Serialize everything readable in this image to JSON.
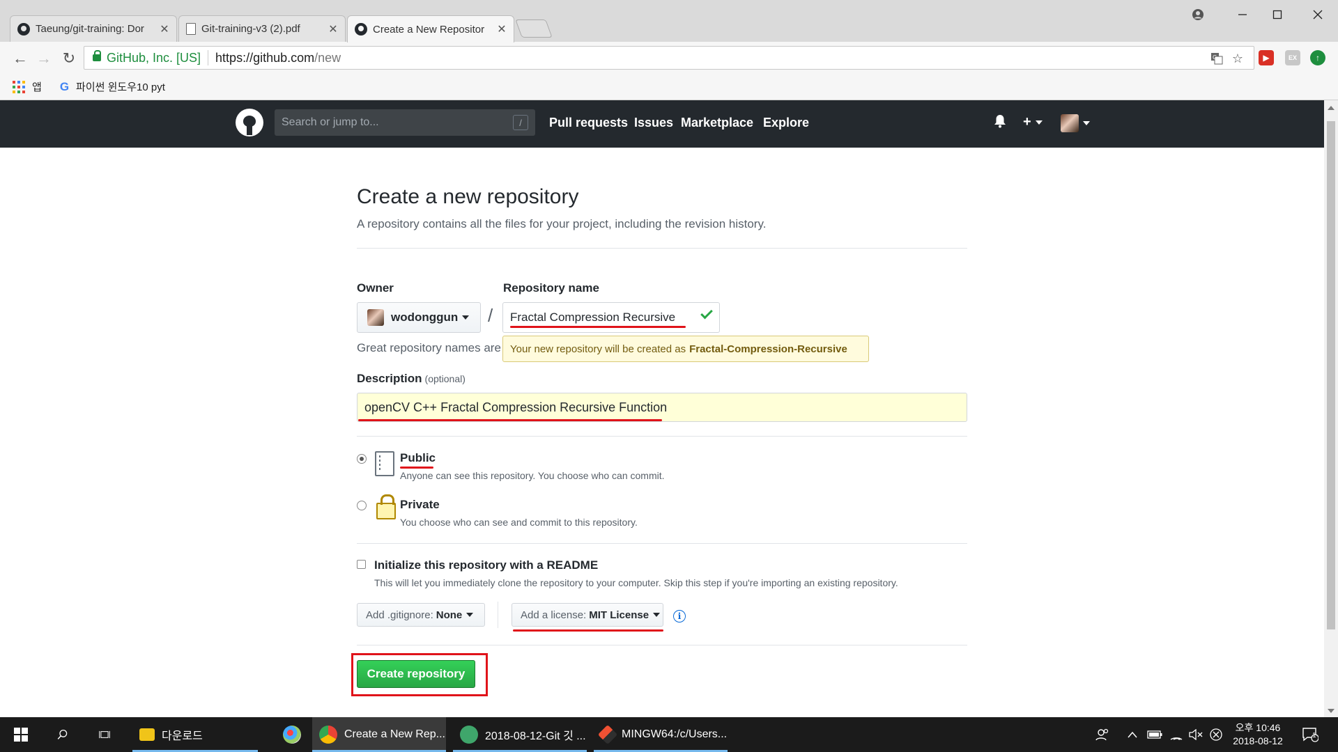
{
  "browser": {
    "tabs": [
      {
        "title": "Taeung/git-training: Dor",
        "icon": "github-icon"
      },
      {
        "title": "Git-training-v3 (2).pdf",
        "icon": "document-icon"
      },
      {
        "title": "Create a New Repositor",
        "icon": "github-icon"
      }
    ],
    "close_glyph": "✕",
    "address": {
      "ev_label": "GitHub, Inc. [US]",
      "url_host": "https://github.com",
      "url_path": "/new"
    },
    "bookmarks": {
      "apps_label": "앱",
      "item_label": "파이썬 윈도우10 pyt"
    }
  },
  "github": {
    "header": {
      "search_placeholder": "Search or jump to...",
      "search_key": "/",
      "nav": [
        "Pull requests",
        "Issues",
        "Marketplace",
        "Explore"
      ],
      "plus_label": "+"
    },
    "page": {
      "title": "Create a new repository",
      "subtitle": "A repository contains all the files for your project, including the revision history.",
      "owner_label": "Owner",
      "owner_value": "wodonggun",
      "repo_name_label": "Repository name",
      "repo_name_value": "Fractal Compression Recursive",
      "slash": "/",
      "hint_text": "Great repository names are",
      "tooltip_prefix": "Your new repository will be created as",
      "tooltip_name": "Fractal-Compression-Recursive",
      "description_label": "Description",
      "description_optional": "(optional)",
      "description_value": "openCV C++ Fractal Compression Recursive Function",
      "visibility": {
        "selected": "public",
        "public_title": "Public",
        "public_desc": "Anyone can see this repository. You choose who can commit.",
        "private_title": "Private",
        "private_desc": "You choose who can see and commit to this repository."
      },
      "init_readme_label": "Initialize this repository with a README",
      "init_readme_desc": "This will let you immediately clone the repository to your computer. Skip this step if you're importing an existing repository.",
      "gitignore_label": "Add .gitignore:",
      "gitignore_value": "None",
      "license_label": "Add a license:",
      "license_value": "MIT License",
      "info_glyph": "i",
      "create_button": "Create repository"
    }
  },
  "taskbar": {
    "items": [
      {
        "label": "다운로드"
      },
      {
        "label": "Create a New Rep..."
      },
      {
        "label": "2018-08-12-Git 깃 ..."
      },
      {
        "label": "MINGW64:/c/Users..."
      }
    ],
    "clock_time": "오후 10:46",
    "clock_date": "2018-08-12",
    "notification_count": "1"
  },
  "colors": {
    "github_header": "#24292e",
    "create_button": "#28a745",
    "annotation_red": "#e0131a",
    "tooltip_bg": "#fffbdd"
  }
}
